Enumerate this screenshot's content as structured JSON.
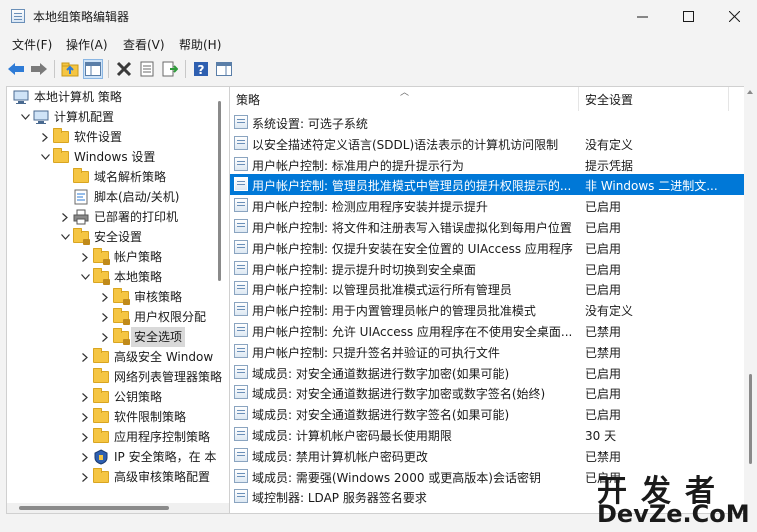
{
  "window": {
    "title": "本地组策略编辑器"
  },
  "menu": [
    "文件(F)",
    "操作(A)",
    "查看(V)",
    "帮助(H)"
  ],
  "tree": [
    {
      "label": "本地计算机 策略",
      "level": 0,
      "twisty": "none",
      "icon": "computer-icon"
    },
    {
      "label": "计算机配置",
      "level": 1,
      "twisty": "down",
      "icon": "computer-icon"
    },
    {
      "label": "软件设置",
      "level": 2,
      "twisty": "right",
      "icon": "folder-icon"
    },
    {
      "label": "Windows 设置",
      "level": 2,
      "twisty": "down",
      "icon": "folder-icon"
    },
    {
      "label": "域名解析策略",
      "level": 3,
      "twisty": "none",
      "icon": "folder-icon"
    },
    {
      "label": "脚本(启动/关机)",
      "level": 3,
      "twisty": "none",
      "icon": "script-icon"
    },
    {
      "label": "已部署的打印机",
      "level": 3,
      "twisty": "right",
      "icon": "printer-icon"
    },
    {
      "label": "安全设置",
      "level": 3,
      "twisty": "down",
      "icon": "security-folder-icon"
    },
    {
      "label": "帐户策略",
      "level": 4,
      "twisty": "right",
      "icon": "security-folder-icon"
    },
    {
      "label": "本地策略",
      "level": 4,
      "twisty": "down",
      "icon": "security-folder-icon"
    },
    {
      "label": "审核策略",
      "level": 5,
      "twisty": "right",
      "icon": "security-folder-icon"
    },
    {
      "label": "用户权限分配",
      "level": 5,
      "twisty": "right",
      "icon": "security-folder-icon"
    },
    {
      "label": "安全选项",
      "level": 5,
      "twisty": "right",
      "icon": "security-folder-icon",
      "selected": true
    },
    {
      "label": "高级安全 Window",
      "level": 4,
      "twisty": "right",
      "icon": "folder-icon"
    },
    {
      "label": "网络列表管理器策略",
      "level": 4,
      "twisty": "none",
      "icon": "folder-icon"
    },
    {
      "label": "公钥策略",
      "level": 4,
      "twisty": "right",
      "icon": "folder-icon"
    },
    {
      "label": "软件限制策略",
      "level": 4,
      "twisty": "right",
      "icon": "folder-icon"
    },
    {
      "label": "应用程序控制策略",
      "level": 4,
      "twisty": "right",
      "icon": "folder-icon"
    },
    {
      "label": "IP 安全策略，在 本",
      "level": 4,
      "twisty": "right",
      "icon": "ipsec-icon"
    },
    {
      "label": "高级审核策略配置",
      "level": 4,
      "twisty": "right",
      "icon": "folder-icon"
    }
  ],
  "list": {
    "columns": [
      "策略",
      "安全设置"
    ],
    "rows": [
      {
        "policy": "系统设置: 可选子系统",
        "setting": ""
      },
      {
        "policy": "以安全描述符定义语言(SDDL)语法表示的计算机访问限制",
        "setting": "没有定义"
      },
      {
        "policy": "用户帐户控制: 标准用户的提升提示行为",
        "setting": "提示凭据"
      },
      {
        "policy": "用户帐户控制: 管理员批准模式中管理员的提升权限提示的...",
        "setting": "非 Windows 二进制文...",
        "selected": true
      },
      {
        "policy": "用户帐户控制: 检测应用程序安装并提示提升",
        "setting": "已启用"
      },
      {
        "policy": "用户帐户控制: 将文件和注册表写入错误虚拟化到每用户位置",
        "setting": "已启用"
      },
      {
        "policy": "用户帐户控制: 仅提升安装在安全位置的 UIAccess 应用程序",
        "setting": "已启用"
      },
      {
        "policy": "用户帐户控制: 提示提升时切换到安全桌面",
        "setting": "已启用"
      },
      {
        "policy": "用户帐户控制: 以管理员批准模式运行所有管理员",
        "setting": "已启用"
      },
      {
        "policy": "用户帐户控制: 用于内置管理员帐户的管理员批准模式",
        "setting": "没有定义"
      },
      {
        "policy": "用户帐户控制: 允许 UIAccess 应用程序在不使用安全桌面...",
        "setting": "已禁用"
      },
      {
        "policy": "用户帐户控制: 只提升签名并验证的可执行文件",
        "setting": "已禁用"
      },
      {
        "policy": "域成员: 对安全通道数据进行数字加密(如果可能)",
        "setting": "已启用"
      },
      {
        "policy": "域成员: 对安全通道数据进行数字加密或数字签名(始终)",
        "setting": "已启用"
      },
      {
        "policy": "域成员: 对安全通道数据进行数字签名(如果可能)",
        "setting": "已启用"
      },
      {
        "policy": "域成员: 计算机帐户密码最长使用期限",
        "setting": "30 天"
      },
      {
        "policy": "域成员: 禁用计算机帐户密码更改",
        "setting": "已禁用"
      },
      {
        "policy": "域成员: 需要强(Windows 2000 或更高版本)会话密钥",
        "setting": "已启用"
      },
      {
        "policy": "域控制器: LDAP 服务器签名要求",
        "setting": ""
      }
    ]
  },
  "watermark": {
    "cn": "开发者",
    "en": "DevZe.CoM"
  },
  "colors": {
    "selection": "#0078d7",
    "chrome": "#f3f3f3"
  }
}
